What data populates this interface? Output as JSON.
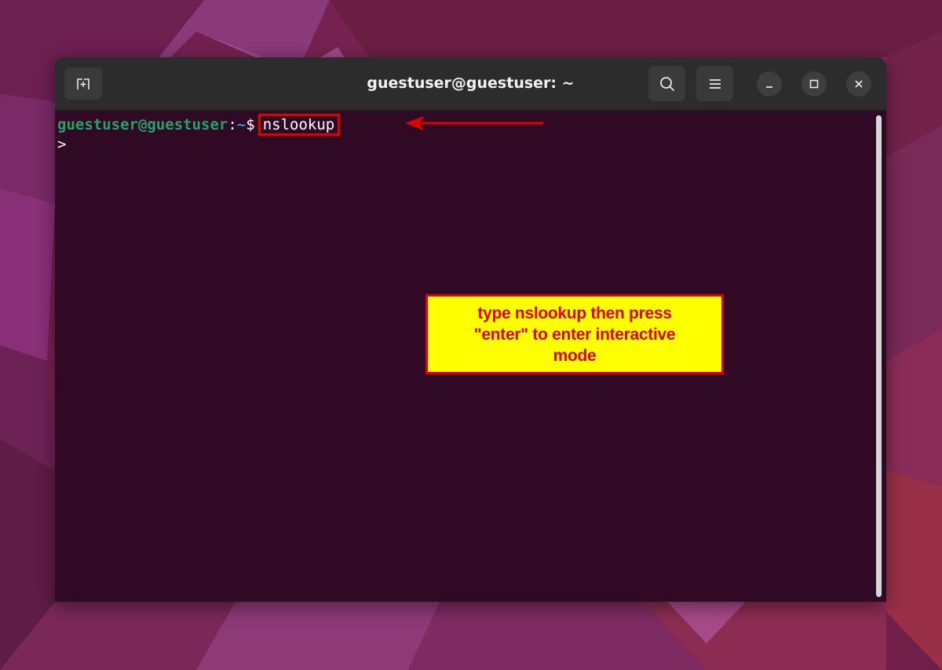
{
  "desktop": {
    "wallpaper_colors": [
      "#6a1f4a",
      "#8a2a55",
      "#a03a6e",
      "#5b1a41"
    ]
  },
  "window": {
    "title": "guestuser@guestuser: ~",
    "header_buttons": {
      "new_tab_icon": "new-tab-icon",
      "search_icon": "search-icon",
      "menu_icon": "hamburger-menu-icon",
      "minimize_icon": "minimize-icon",
      "maximize_icon": "maximize-icon",
      "close_icon": "close-icon"
    },
    "background_color": "#300a24",
    "header_color": "#2c2c2c"
  },
  "terminal": {
    "prompt": {
      "user_host": "guestuser@guestuser",
      "colon": ":",
      "path": "~",
      "dollar": "$"
    },
    "command": "nslookup",
    "second_line": ">",
    "prompt_user_color": "#26a269",
    "prompt_path_color": "#3b8be0"
  },
  "annotation": {
    "callout_text_line1": "type nslookup then press",
    "callout_text_line2": "\"enter\" to enter interactive",
    "callout_text_line3": "mode",
    "highlight_color": "#e00000",
    "callout_background": "#ffff00"
  }
}
